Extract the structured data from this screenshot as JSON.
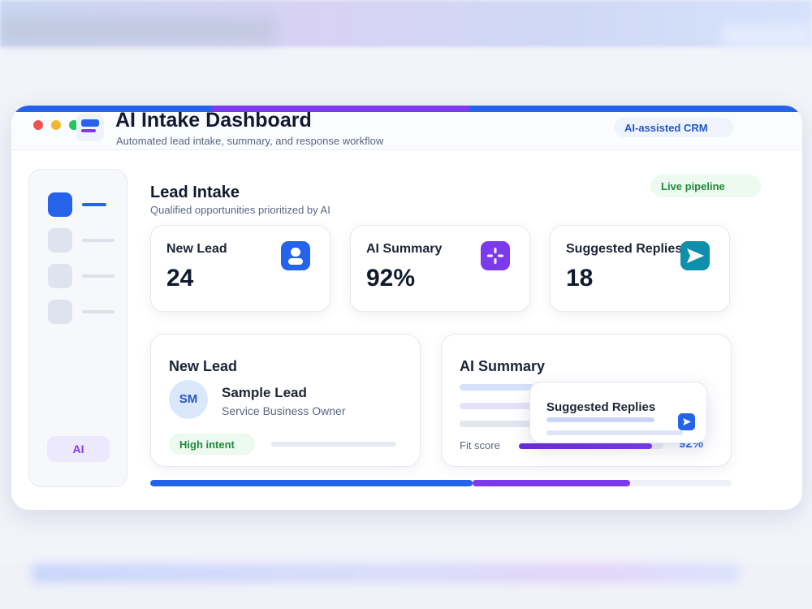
{
  "colors": {
    "accent_blue": "#2563eb",
    "accent_purple": "#7c3aed",
    "accent_teal": "#0e8fab",
    "success_green": "#1f8a3b",
    "window_dots": [
      "#ef5350",
      "#f2b631",
      "#22c55e"
    ]
  },
  "window": {
    "title": "AI Intake Dashboard",
    "subtitle": "Automated lead intake, summary, and response workflow",
    "badge": "AI-assisted CRM",
    "app_icon": "dashboard-icon"
  },
  "sidebar": {
    "items": [
      {
        "name": "nav-item-1",
        "active": true
      },
      {
        "name": "nav-item-2",
        "active": false
      },
      {
        "name": "nav-item-3",
        "active": false
      },
      {
        "name": "nav-item-4",
        "active": false
      }
    ],
    "ai_button": "AI"
  },
  "section": {
    "title": "Lead Intake",
    "subtitle": "Qualified opportunities prioritized by AI",
    "status_badge": "Live pipeline"
  },
  "stats": [
    {
      "label": "New Lead",
      "value": "24",
      "icon": "user-icon"
    },
    {
      "label": "AI Summary",
      "value": "92%",
      "icon": "sparkle-icon"
    },
    {
      "label": "Suggested Replies",
      "value": "18",
      "icon": "send-icon"
    }
  ],
  "lead_card": {
    "title": "New Lead",
    "avatar_initials": "SM",
    "name": "Sample Lead",
    "role": "Service Business Owner",
    "intent_badge": "High intent"
  },
  "summary_card": {
    "title": "AI Summary",
    "fit_label": "Fit score",
    "fit_value": "92%",
    "fit_fraction": 0.92
  },
  "replies_popover": {
    "title": "Suggested Replies",
    "icon": "send-icon"
  },
  "workflow_progress": {
    "stage_1_fraction": 0.555,
    "stage_2_fraction": 0.27
  }
}
